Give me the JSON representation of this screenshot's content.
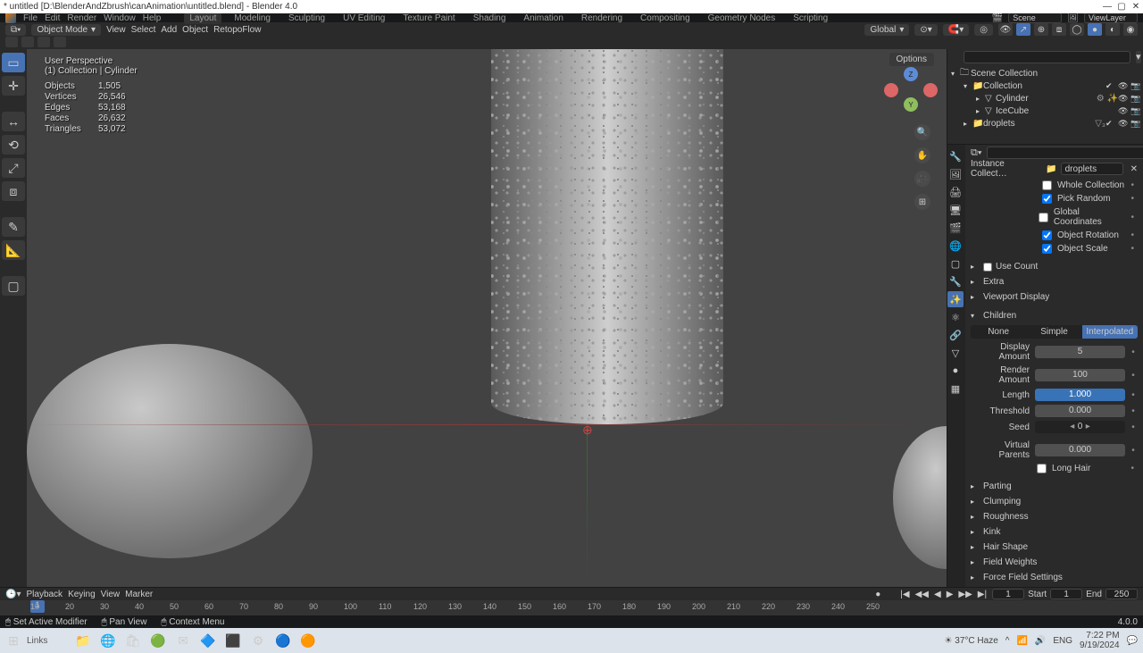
{
  "window": {
    "title": "* untitled [D:\\BlenderAndZbrush\\canAnimation\\untitled.blend] - Blender 4.0",
    "min": "—",
    "max": "▢",
    "close": "✕"
  },
  "menu": {
    "items": [
      "File",
      "Edit",
      "Render",
      "Window",
      "Help"
    ],
    "tabs": [
      "Layout",
      "Modeling",
      "Sculpting",
      "UV Editing",
      "Texture Paint",
      "Shading",
      "Animation",
      "Rendering",
      "Compositing",
      "Geometry Nodes",
      "Scripting"
    ],
    "scene_lbl": "Scene",
    "scene": "Scene",
    "layer_lbl": "ViewLayer",
    "layer": "ViewLayer"
  },
  "toolbar": {
    "mode": "Object Mode",
    "menus": [
      "View",
      "Select",
      "Add",
      "Object",
      "RetopoFlow"
    ],
    "orientation": "Global",
    "options": "Options"
  },
  "viewport": {
    "persp": "User Perspective",
    "coll_line": "(1) Collection | Cylinder",
    "stats": [
      [
        "Objects",
        "1,505"
      ],
      [
        "Vertices",
        "26,546"
      ],
      [
        "Edges",
        "53,168"
      ],
      [
        "Faces",
        "26,632"
      ],
      [
        "Triangles",
        "53,072"
      ]
    ]
  },
  "outliner": {
    "root": "Scene Collection",
    "items": [
      {
        "indent": 14,
        "tw": "▾",
        "ic": "📁",
        "name": "Collection",
        "vis": [
          "✔",
          "👁",
          "📷"
        ]
      },
      {
        "indent": 28,
        "tw": "▸",
        "ic": "▽",
        "name": "Cylinder",
        "tail": "⚙ ✨",
        "vis": [
          "👁",
          "📷"
        ]
      },
      {
        "indent": 28,
        "tw": "▸",
        "ic": "▽",
        "name": "IceCube",
        "vis": [
          "👁",
          "📷"
        ]
      },
      {
        "indent": 14,
        "tw": "▸",
        "ic": "📁",
        "name": "droplets",
        "tail": "▽₃",
        "vis": [
          "✔",
          "👁",
          "📷"
        ]
      }
    ]
  },
  "props": {
    "header": "Instance Collect…",
    "dropval": "droplets",
    "checks": [
      {
        "checked": false,
        "label": "Whole Collection"
      },
      {
        "checked": true,
        "label": "Pick Random"
      },
      {
        "checked": false,
        "label": "Global Coordinates"
      },
      {
        "checked": true,
        "label": "Object Rotation"
      },
      {
        "checked": true,
        "label": "Object Scale"
      }
    ],
    "collapsers1": [
      {
        "tw": "▸",
        "label": "Use Count",
        "cb": true
      },
      {
        "tw": "▸",
        "label": "Extra"
      },
      {
        "tw": "▸",
        "label": "Viewport Display"
      }
    ],
    "children_hdr": "Children",
    "tabs3": [
      {
        "label": "None",
        "active": false
      },
      {
        "label": "Simple",
        "active": false
      },
      {
        "label": "Interpolated",
        "active": true
      }
    ],
    "rows": [
      {
        "label": "Display Amount",
        "val": "5"
      },
      {
        "label": "Render Amount",
        "val": "100"
      },
      {
        "label": "Length",
        "val": "1.000",
        "hl": true
      },
      {
        "label": "Threshold",
        "val": "0.000"
      },
      {
        "label": "Seed",
        "val": "0",
        "seed": true
      }
    ],
    "vp_label": "Virtual Parents",
    "vp_val": "0.000",
    "longhair": {
      "checked": false,
      "label": "Long Hair"
    },
    "collapsers2": [
      "Parting",
      "Clumping",
      "Roughness",
      "Kink",
      "Hair Shape",
      "Field Weights",
      "Force Field Settings"
    ]
  },
  "timeline": {
    "menus": [
      "Playback",
      "Keying",
      "View",
      "Marker"
    ],
    "frame": "1",
    "start_lbl": "Start",
    "start": "1",
    "end_lbl": "End",
    "end": "250",
    "ticks": [
      10,
      30,
      50,
      70,
      90,
      110,
      130,
      150,
      170,
      190,
      210,
      230,
      250
    ],
    "tick_labels": [
      10,
      20,
      30,
      40,
      50,
      60,
      70,
      80,
      90,
      100,
      110,
      120,
      130,
      140,
      150,
      160,
      170,
      180,
      190,
      200,
      210,
      220,
      230,
      240,
      250
    ]
  },
  "status": {
    "l1": "Set Active Modifier",
    "l2": "Pan View",
    "l3": "Context Menu",
    "ver": "4.0.0"
  },
  "taskbar": {
    "search": "Links",
    "weather": "37°C Haze",
    "time": "7:22 PM",
    "date": "9/19/2024",
    "lang": "ENG"
  }
}
